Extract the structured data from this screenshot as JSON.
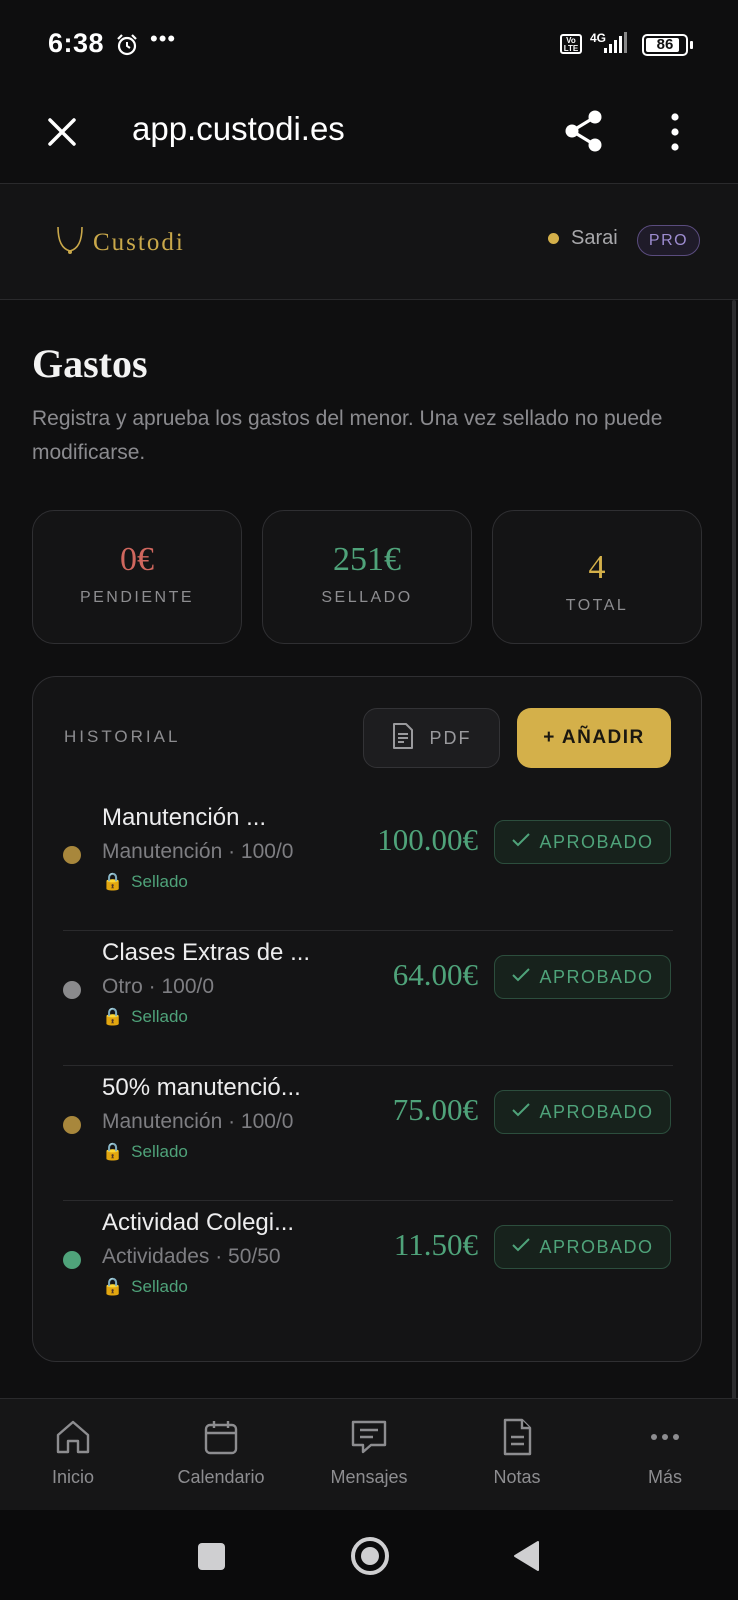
{
  "status_bar": {
    "time": "6:38",
    "more": "•••",
    "network": "4G",
    "volte": "Vo LTE",
    "battery": "86",
    "battery_level": 0.86
  },
  "browser": {
    "url": "app.custodi.es"
  },
  "app_header": {
    "logo_text": "Custodi",
    "user_name": "Sarai",
    "plan_badge": "PRO"
  },
  "page": {
    "title": "Gastos",
    "description": "Registra y aprueba los gastos del menor. Una vez sellado no puede modificarse."
  },
  "stats": [
    {
      "value": "0€",
      "label": "PENDIENTE",
      "color": "#d0675e"
    },
    {
      "value": "251€",
      "label": "SELLADO",
      "color": "#4fa37a"
    },
    {
      "value": "4",
      "label": "TOTAL",
      "color": "#d4b04a"
    }
  ],
  "history": {
    "label": "HISTORIAL",
    "pdf_button": "PDF",
    "add_button": "+ AÑADIR",
    "rows": [
      {
        "title": "Manutención ...",
        "subtitle": "Manutención · 100/0",
        "seal": "Sellado",
        "amount": "100.00€",
        "status": "APROBADO",
        "dot_color": "#a8873c"
      },
      {
        "title": "Clases Extras de ...",
        "subtitle": "Otro · 100/0",
        "seal": "Sellado",
        "amount": "64.00€",
        "status": "APROBADO",
        "dot_color": "#8a8a8c"
      },
      {
        "title": "50% manutenció...",
        "subtitle": "Manutención · 100/0",
        "seal": "Sellado",
        "amount": "75.00€",
        "status": "APROBADO",
        "dot_color": "#a8873c"
      },
      {
        "title": "Actividad Colegi...",
        "subtitle": "Actividades · 50/50",
        "seal": "Sellado",
        "amount": "11.50€",
        "status": "APROBADO",
        "dot_color": "#4fa37a"
      }
    ]
  },
  "bottom_nav": [
    {
      "label": "Inicio",
      "icon": "home-icon"
    },
    {
      "label": "Calendario",
      "icon": "calendar-icon"
    },
    {
      "label": "Mensajes",
      "icon": "message-icon"
    },
    {
      "label": "Notas",
      "icon": "notes-icon"
    },
    {
      "label": "Más",
      "icon": "more-icon"
    }
  ],
  "colors": {
    "accent": "#d4b04a",
    "success": "#4fa37a",
    "pending": "#d0675e",
    "background": "#0f0f10"
  }
}
